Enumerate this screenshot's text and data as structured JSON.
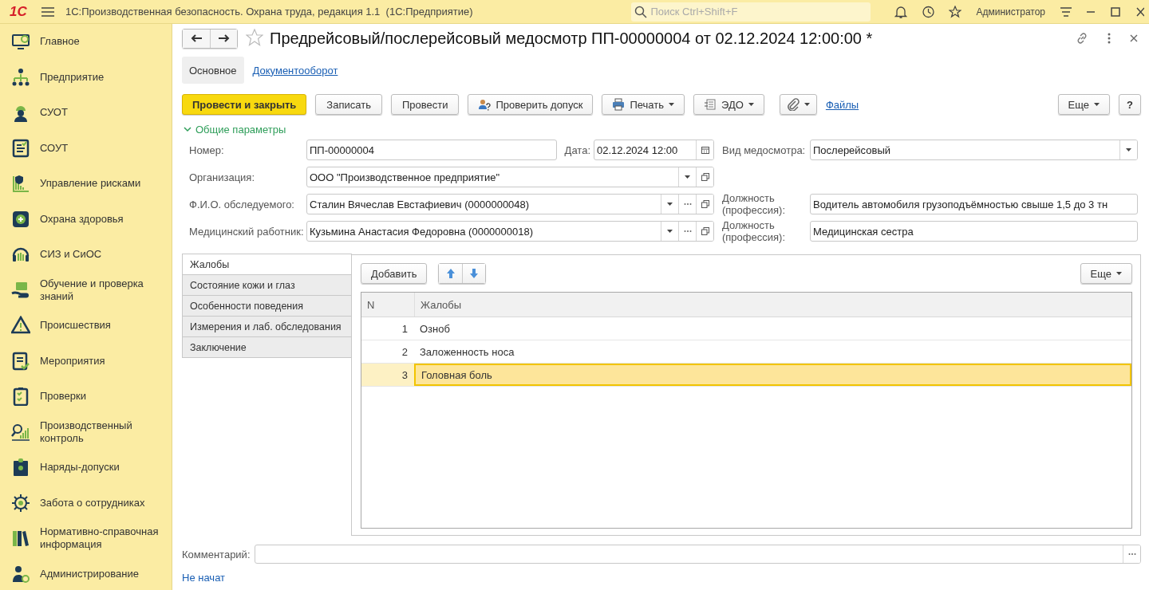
{
  "app_bar": {
    "logo": "1С",
    "title": "1С:Производственная безопасность. Охрана труда, редакция 1.1  (1С:Предприятие)",
    "search": {
      "placeholder": "Поиск Ctrl+Shift+F"
    },
    "user": "Администратор"
  },
  "sidebar": {
    "items": [
      {
        "label": "Главное"
      },
      {
        "label": "Предприятие"
      },
      {
        "label": "СУОТ"
      },
      {
        "label": "СОУТ"
      },
      {
        "label": "Управление рисками"
      },
      {
        "label": "Охрана здоровья"
      },
      {
        "label": "СИЗ и СиОС"
      },
      {
        "label": "Обучение и проверка знаний"
      },
      {
        "label": "Происшествия"
      },
      {
        "label": "Мероприятия"
      },
      {
        "label": "Проверки"
      },
      {
        "label": "Производственный контроль"
      },
      {
        "label": "Наряды-допуски"
      },
      {
        "label": "Забота о сотрудниках"
      },
      {
        "label": "Нормативно-справочная информация"
      },
      {
        "label": "Администрирование"
      }
    ]
  },
  "document": {
    "title": "Предрейсовый/послерейсовый медосмотр ПП-00000004 от 02.12.2024 12:00:00 *",
    "tabs": [
      {
        "label": "Основное",
        "selected": true
      },
      {
        "label": "Документооборот",
        "selected": false
      }
    ],
    "toolbar": [
      {
        "kind": "primary",
        "label": "Провести и закрыть"
      },
      {
        "kind": "plain",
        "label": "Записать"
      },
      {
        "kind": "plain",
        "label": "Провести"
      },
      {
        "kind": "check",
        "label": "Проверить допуск"
      },
      {
        "kind": "print",
        "label": "Печать"
      },
      {
        "kind": "edo",
        "label": "ЭДО"
      },
      {
        "kind": "attach"
      },
      {
        "kind": "link",
        "label": "Файлы"
      }
    ],
    "more": "Еще",
    "help": "?",
    "group": {
      "title": "Общие параметры",
      "expanded": true
    },
    "number": {
      "label": "Номер:",
      "value": "ПП-00000004"
    },
    "date": {
      "label": "Дата:",
      "value": "02.12.2024 12:00"
    },
    "exam_type": {
      "label": "Вид медосмотра:",
      "value": "Послерейсовый"
    },
    "organization": {
      "label": "Организация:",
      "value": "ООО \"Производственное предприятие\""
    },
    "examinee": {
      "label": "Ф.И.О. обследуемого:",
      "value": "Сталин Вячеслав Евстафиевич (0000000048)"
    },
    "examinee_position": {
      "label": "Должность (профессия):",
      "value": "Водитель автомобиля грузоподъёмностью свыше 1,5 до 3 тн"
    },
    "medic": {
      "label": "Медицинский работник:",
      "value": "Кузьмина Анастасия Федоровна (0000000018)"
    },
    "medic_position": {
      "label": "Должность (профессия):",
      "value": "Медицинская сестра"
    },
    "section_tabs": [
      {
        "label": "Жалобы",
        "selected": true
      },
      {
        "label": "Состояние кожи и глаз",
        "selected": false
      },
      {
        "label": "Особенности поведения",
        "selected": false
      },
      {
        "label": "Измерения и лаб. обследования",
        "selected": false
      },
      {
        "label": "Заключение",
        "selected": false
      }
    ],
    "table": {
      "add": "Добавить",
      "more": "Еще",
      "columns": [
        "N",
        "Жалобы"
      ],
      "rows": [
        {
          "n": "1",
          "text": "Озноб",
          "selected": false
        },
        {
          "n": "2",
          "text": "Заложенность носа",
          "selected": false
        },
        {
          "n": "3",
          "text": "Головная боль",
          "selected": true
        }
      ]
    },
    "comment": {
      "label": "Комментарий:"
    },
    "status": "Не начат"
  }
}
